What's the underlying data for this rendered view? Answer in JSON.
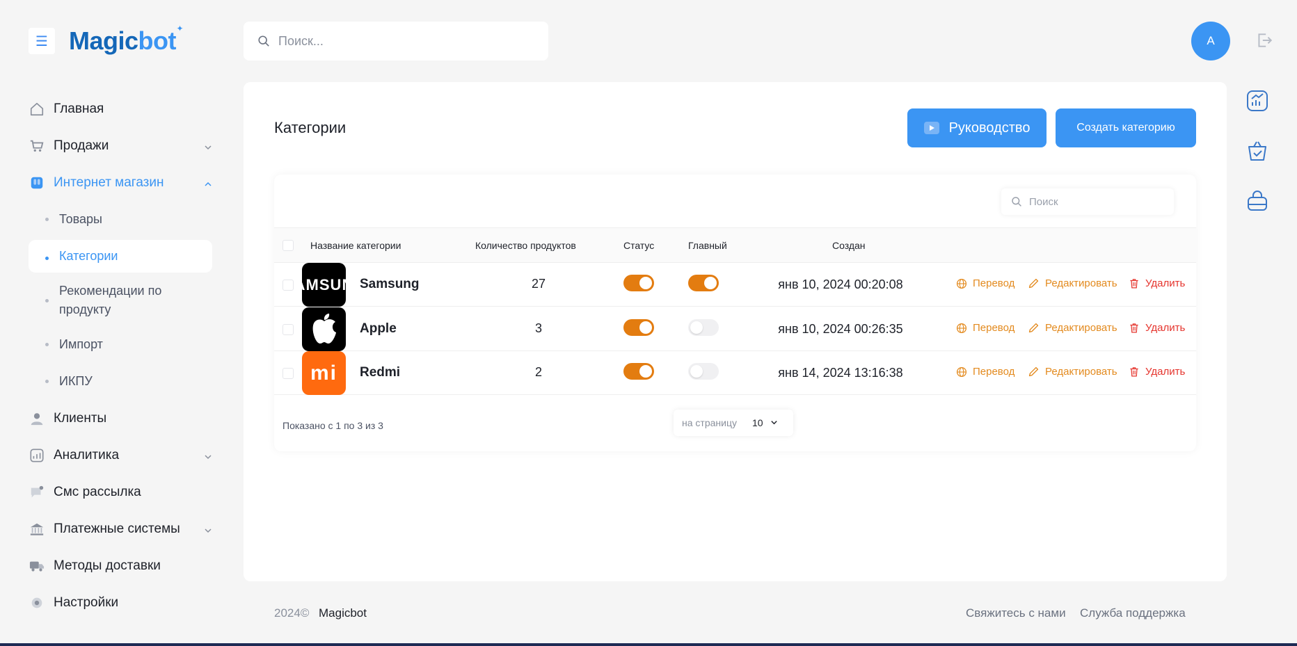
{
  "brand": {
    "part1": "Magic",
    "part2": "bot"
  },
  "search": {
    "placeholder": "Поиск..."
  },
  "user": {
    "initial": "A"
  },
  "sidebar": {
    "items": [
      {
        "label": "Главная"
      },
      {
        "label": "Продажи"
      },
      {
        "label": "Интернет магазин"
      },
      {
        "label": "Клиенты"
      },
      {
        "label": "Аналитика"
      },
      {
        "label": "Смс рассылка"
      },
      {
        "label": "Платежные системы"
      },
      {
        "label": "Методы доставки"
      },
      {
        "label": "Настройки"
      }
    ],
    "shop_sub": [
      {
        "label": "Товары"
      },
      {
        "label": "Категории"
      },
      {
        "label": "Рекомендации по продукту"
      },
      {
        "label": "Импорт"
      },
      {
        "label": "ИКПУ"
      }
    ]
  },
  "main": {
    "title": "Категории",
    "guide_button": "Руководство",
    "create_button": "Создать категорию",
    "table_search_placeholder": "Поиск",
    "columns": {
      "name": "Название категории",
      "count": "Количество продуктов",
      "status": "Статус",
      "main": "Главный",
      "created": "Создан"
    },
    "actions": {
      "translate": "Перевод",
      "edit": "Редактировать",
      "delete": "Удалить"
    },
    "rows": [
      {
        "name": "Samsung",
        "count": "27",
        "status": true,
        "main": true,
        "created": "янв 10, 2024 00:20:08",
        "logo_text": "AMSUN"
      },
      {
        "name": "Apple",
        "count": "3",
        "status": true,
        "main": false,
        "created": "янв 10, 2024 00:26:35"
      },
      {
        "name": "Redmi",
        "count": "2",
        "status": true,
        "main": false,
        "created": "янв 14, 2024 13:16:38",
        "logo_text": "mi"
      }
    ],
    "pagination": {
      "shown": "Показано с 1 по 3 из 3",
      "per_page_label": "на страницу",
      "per_page_value": "10"
    }
  },
  "footer": {
    "year": "2024©",
    "brand": "Magicbot",
    "contact": "Свяжитесь с нами",
    "support": "Служба поддержка"
  },
  "colors": {
    "accent": "#3b95f3",
    "toggle_on": "#e37c10",
    "action": "#e38a1e",
    "delete": "#e5342d"
  }
}
